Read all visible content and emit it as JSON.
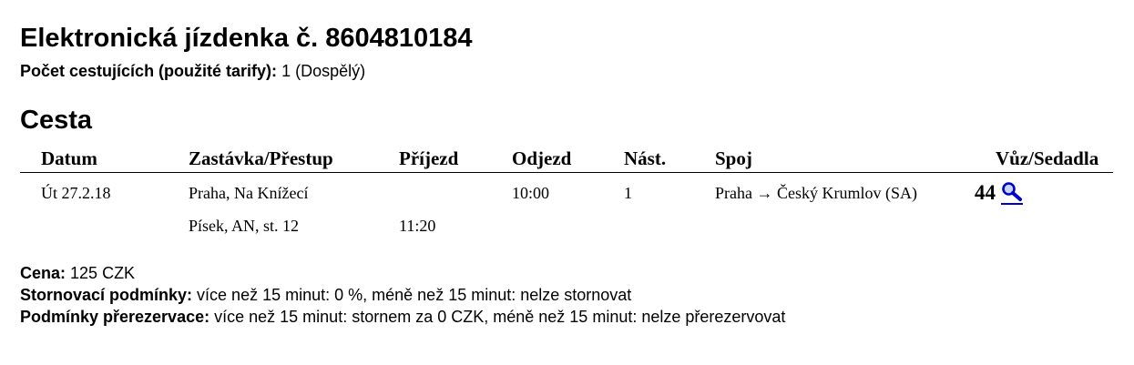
{
  "ticket": {
    "title": "Elektronická jízdenka č. 8604810184",
    "passengers_label": "Počet cestujících (použité tarify):",
    "passengers_value": "1 (Dospělý)"
  },
  "journey": {
    "heading": "Cesta",
    "columns": {
      "date": "Datum",
      "stop": "Zastávka/Přestup",
      "arrival": "Příjezd",
      "departure": "Odjezd",
      "platform": "Nást.",
      "connection": "Spoj",
      "seats": "Vůz/Sedadla"
    },
    "rows": [
      {
        "date": "Út 27.2.18",
        "stop": "Praha, Na Knížecí",
        "arrival": "",
        "departure": "10:00",
        "platform": "1",
        "connection": "Praha → Český Krumlov (SA)",
        "seat": "44",
        "seat_icon": "magnifier-icon"
      },
      {
        "date": "",
        "stop": "Písek, AN, st. 12",
        "arrival": "11:20",
        "departure": "",
        "platform": "",
        "connection": "",
        "seat": ""
      }
    ]
  },
  "summary": {
    "price_label": "Cena:",
    "price_value": "125 CZK",
    "cancel_label": "Stornovací podmínky:",
    "cancel_value": "více než 15 minut: 0 %, méně než 15 minut: nelze stornovat",
    "rebook_label": "Podmínky přerezervace:",
    "rebook_value": "více než 15 minut: stornem za 0 CZK, méně než 15 minut: nelze přerezervovat"
  },
  "colors": {
    "link": "#0000cc",
    "text": "#000000"
  }
}
